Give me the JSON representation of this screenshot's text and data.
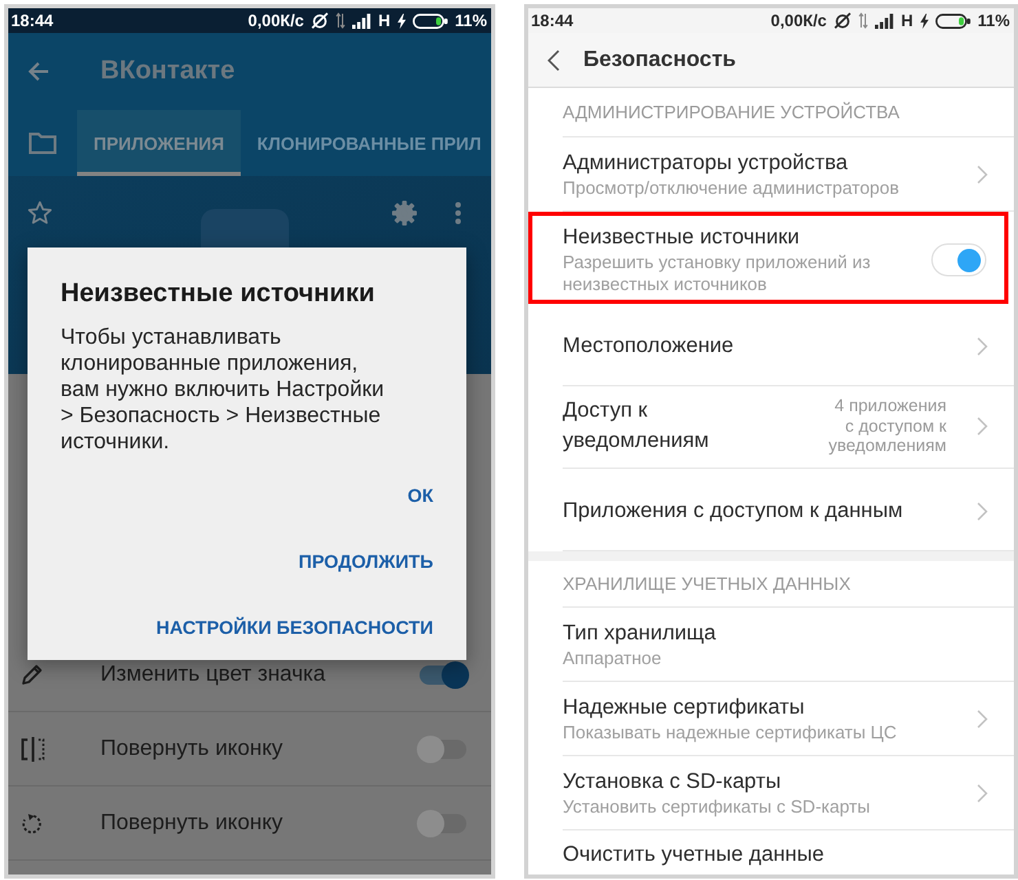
{
  "left_screen": {
    "status_bar": {
      "time": "18:44",
      "speed": "0,00К/с",
      "network": "H",
      "battery": "11%"
    },
    "app_bar": {
      "title": "ВКонтакте"
    },
    "tabs": [
      {
        "label": "ПРИЛОЖЕНИЯ",
        "selected": true
      },
      {
        "label": "КЛОНИРОВАННЫЕ ПРИЛ",
        "selected": false
      }
    ],
    "options": [
      {
        "kind": "color",
        "label": "Изменить цвет значка",
        "on": true
      },
      {
        "kind": "flip",
        "label": "Повернуть иконку",
        "on": false
      },
      {
        "kind": "rotate",
        "label": "Повернуть иконку",
        "on": false
      }
    ],
    "dialog": {
      "title": "Неизвестные источники",
      "message": "Чтобы устанавливать клонированные приложения, вам нужно включить Настройки > Безопасность > Неизвестные источники.",
      "buttons": [
        "ОК",
        "ПРОДОЛЖИТЬ",
        "НАСТРОЙКИ БЕЗОПАСНОСТИ"
      ]
    }
  },
  "right_screen": {
    "status_bar": {
      "time": "18:44",
      "speed": "0,00К/с",
      "network": "H",
      "battery": "11%"
    },
    "title": "Безопасность",
    "sections": [
      {
        "header": "АДМИНИСТРИРОВАНИЕ УСТРОЙСТВА",
        "items": [
          {
            "kind": "link",
            "title": "Администраторы устройства",
            "subtitle": "Просмотр/отключение администраторов",
            "highlighted": false
          },
          {
            "kind": "toggle",
            "title": "Неизвестные источники",
            "subtitle": "Разрешить установку приложений из неизвестных источников",
            "on": true,
            "highlighted": true
          },
          {
            "kind": "link",
            "title": "Местоположение",
            "highlighted": false
          },
          {
            "kind": "link",
            "title": "Доступ к уведомлениям",
            "value": "4 приложения с доступом к уведомлениям",
            "highlighted": false
          },
          {
            "kind": "link",
            "title": "Приложения с доступом к данным",
            "highlighted": false
          }
        ]
      },
      {
        "header": "ХРАНИЛИЩЕ УЧЕТНЫХ ДАННЫХ",
        "items": [
          {
            "kind": "plain",
            "title": "Тип хранилища",
            "subtitle": "Аппаратное",
            "highlighted": false
          },
          {
            "kind": "link",
            "title": "Надежные сертификаты",
            "subtitle": "Показывать надежные сертификаты ЦС",
            "highlighted": false
          },
          {
            "kind": "link",
            "title": "Установка с SD-карты",
            "subtitle": "Установить сертификаты с SD-карты",
            "highlighted": false
          },
          {
            "kind": "plain",
            "title": "Очистить учетные данные",
            "highlighted": false
          }
        ]
      }
    ]
  }
}
